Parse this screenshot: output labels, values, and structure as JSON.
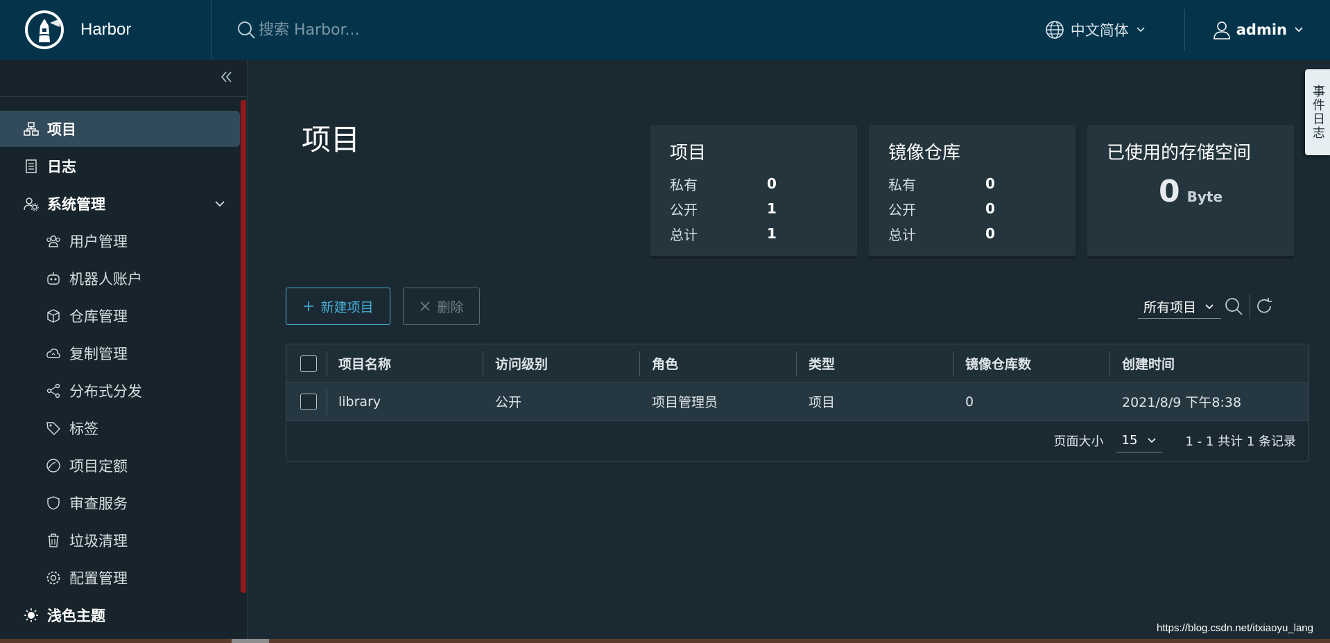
{
  "header": {
    "brand": "Harbor",
    "search_placeholder": "搜索 Harbor...",
    "language": "中文简体",
    "user": "admin"
  },
  "sidebar": {
    "items": [
      {
        "label": "项目",
        "icon": "projects-icon",
        "active": true
      },
      {
        "label": "日志",
        "icon": "log-icon"
      },
      {
        "label": "系统管理",
        "icon": "admin-icon",
        "expanded": true
      },
      {
        "label": "用户管理",
        "icon": "users-icon"
      },
      {
        "label": "机器人账户",
        "icon": "robot-icon"
      },
      {
        "label": "仓库管理",
        "icon": "box-icon"
      },
      {
        "label": "复制管理",
        "icon": "cloud-sync-icon"
      },
      {
        "label": "分布式分发",
        "icon": "share-icon"
      },
      {
        "label": "标签",
        "icon": "tag-icon"
      },
      {
        "label": "项目定额",
        "icon": "quota-icon"
      },
      {
        "label": "审查服务",
        "icon": "shield-icon"
      },
      {
        "label": "垃圾清理",
        "icon": "trash-icon"
      },
      {
        "label": "配置管理",
        "icon": "gear-icon"
      },
      {
        "label": "浅色主题",
        "icon": "sun-icon"
      }
    ]
  },
  "main": {
    "title": "项目",
    "cards": {
      "projects": {
        "title": "项目",
        "rows": [
          {
            "k": "私有",
            "v": "0"
          },
          {
            "k": "公开",
            "v": "1"
          },
          {
            "k": "总计",
            "v": "1"
          }
        ]
      },
      "repos": {
        "title": "镜像仓库",
        "rows": [
          {
            "k": "私有",
            "v": "0"
          },
          {
            "k": "公开",
            "v": "0"
          },
          {
            "k": "总计",
            "v": "0"
          }
        ]
      },
      "storage": {
        "title": "已使用的存储空间",
        "value": "0",
        "unit": "Byte"
      }
    },
    "buttons": {
      "new_project": "新建项目",
      "delete": "删除"
    },
    "filter": "所有项目",
    "table": {
      "columns": [
        "项目名称",
        "访问级别",
        "角色",
        "类型",
        "镜像仓库数",
        "创建时间"
      ],
      "rows": [
        [
          "library",
          "公开",
          "项目管理员",
          "项目",
          "0",
          "2021/8/9 下午8:38"
        ]
      ],
      "footer": {
        "page_size_label": "页面大小",
        "page_size": "15",
        "summary": "1 - 1 共计 1 条记录"
      }
    }
  },
  "event_tab": "事件日志",
  "watermark": "https://blog.csdn.net/itxiaoyu_lang",
  "colors": {
    "header_bg": "#03344c",
    "sidebar_bg": "#17242b",
    "main_bg": "#1b2a32",
    "accent": "#49afd9",
    "active_item": "#324b5a"
  }
}
